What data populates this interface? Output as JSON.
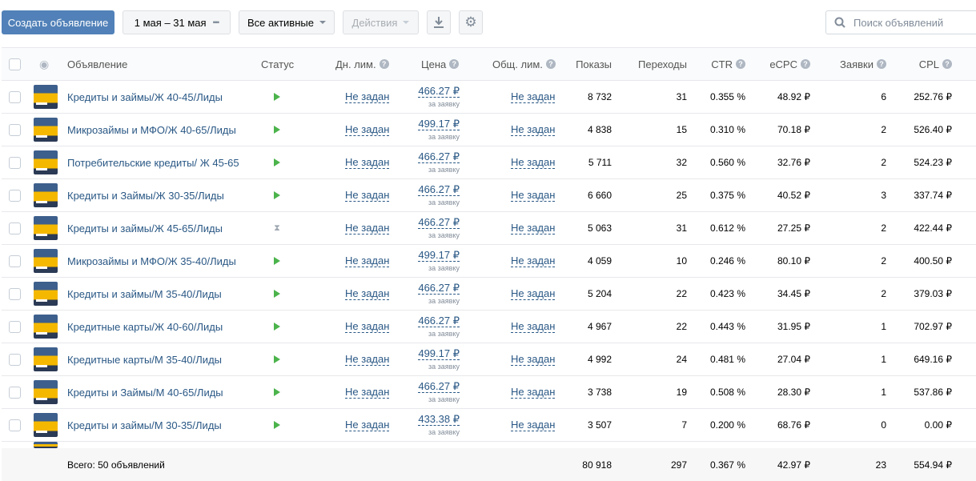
{
  "toolbar": {
    "create_label": "Создать объявление",
    "date_range": "1 мая – 31 мая",
    "filter": "Все активные",
    "actions": "Действия",
    "search_placeholder": "Поиск объявлений"
  },
  "columns": {
    "ad": "Объявление",
    "status": "Статус",
    "day_limit": "Дн. лим.",
    "price": "Цена",
    "total_limit": "Общ. лим.",
    "shows": "Показы",
    "clicks": "Переходы",
    "ctr": "CTR",
    "ecpc": "eCPC",
    "leads": "Заявки",
    "cpl": "CPL"
  },
  "price_sub": "за заявку",
  "rows": [
    {
      "name": "Кредиты и займы/Ж 40-45/Лиды",
      "status": "active",
      "day_limit": "Не задан",
      "price": "466.27 ₽",
      "total_limit": "Не задан",
      "shows": "8 732",
      "clicks": "31",
      "ctr": "0.355 %",
      "ecpc": "48.92 ₽",
      "leads": "6",
      "cpl": "252.76 ₽"
    },
    {
      "name": "Микрозаймы и МФО/Ж 40-65/Лиды",
      "status": "active",
      "day_limit": "Не задан",
      "price": "499.17 ₽",
      "total_limit": "Не задан",
      "shows": "4 838",
      "clicks": "15",
      "ctr": "0.310 %",
      "ecpc": "70.18 ₽",
      "leads": "2",
      "cpl": "526.40 ₽"
    },
    {
      "name": "Потребительские кредиты/ Ж 45-65",
      "status": "active",
      "day_limit": "Не задан",
      "price": "466.27 ₽",
      "total_limit": "Не задан",
      "shows": "5 711",
      "clicks": "32",
      "ctr": "0.560 %",
      "ecpc": "32.76 ₽",
      "leads": "2",
      "cpl": "524.23 ₽"
    },
    {
      "name": "Кредиты и Займы/Ж 30-35/Лиды",
      "status": "active",
      "day_limit": "Не задан",
      "price": "466.27 ₽",
      "total_limit": "Не задан",
      "shows": "6 660",
      "clicks": "25",
      "ctr": "0.375 %",
      "ecpc": "40.52 ₽",
      "leads": "3",
      "cpl": "337.74 ₽"
    },
    {
      "name": "Кредиты и займы/Ж 45-65/Лиды",
      "status": "pending",
      "day_limit": "Не задан",
      "price": "466.27 ₽",
      "total_limit": "Не задан",
      "shows": "5 063",
      "clicks": "31",
      "ctr": "0.612 %",
      "ecpc": "27.25 ₽",
      "leads": "2",
      "cpl": "422.44 ₽"
    },
    {
      "name": "Микрозаймы и МФО/Ж 35-40/Лиды",
      "status": "active",
      "day_limit": "Не задан",
      "price": "499.17 ₽",
      "total_limit": "Не задан",
      "shows": "4 059",
      "clicks": "10",
      "ctr": "0.246 %",
      "ecpc": "80.10 ₽",
      "leads": "2",
      "cpl": "400.50 ₽"
    },
    {
      "name": "Кредиты и займы/М 35-40/Лиды",
      "status": "active",
      "day_limit": "Не задан",
      "price": "466.27 ₽",
      "total_limit": "Не задан",
      "shows": "5 204",
      "clicks": "22",
      "ctr": "0.423 %",
      "ecpc": "34.45 ₽",
      "leads": "2",
      "cpl": "379.03 ₽"
    },
    {
      "name": "Кредитные карты/Ж 40-60/Лиды",
      "status": "active",
      "day_limit": "Не задан",
      "price": "466.27 ₽",
      "total_limit": "Не задан",
      "shows": "4 967",
      "clicks": "22",
      "ctr": "0.443 %",
      "ecpc": "31.95 ₽",
      "leads": "1",
      "cpl": "702.97 ₽"
    },
    {
      "name": "Кредитные карты/М 35-40/Лиды",
      "status": "active",
      "day_limit": "Не задан",
      "price": "499.17 ₽",
      "total_limit": "Не задан",
      "shows": "4 992",
      "clicks": "24",
      "ctr": "0.481 %",
      "ecpc": "27.04 ₽",
      "leads": "1",
      "cpl": "649.16 ₽"
    },
    {
      "name": "Кредиты и Займы/М 40-65/Лиды",
      "status": "active",
      "day_limit": "Не задан",
      "price": "466.27 ₽",
      "total_limit": "Не задан",
      "shows": "3 738",
      "clicks": "19",
      "ctr": "0.508 %",
      "ecpc": "28.30 ₽",
      "leads": "1",
      "cpl": "537.86 ₽"
    },
    {
      "name": "Кредиты и займы/М 30-35/Лиды",
      "status": "active",
      "day_limit": "Не задан",
      "price": "433.38 ₽",
      "total_limit": "Не задан",
      "shows": "3 507",
      "clicks": "7",
      "ctr": "0.200 %",
      "ecpc": "68.76 ₽",
      "leads": "0",
      "cpl": "0.00 ₽"
    }
  ],
  "footer": {
    "total_label": "Всего: 50 объявлений",
    "shows": "80 918",
    "clicks": "297",
    "ctr": "0.367 %",
    "ecpc": "42.97 ₽",
    "leads": "23",
    "cpl": "554.94 ₽"
  }
}
